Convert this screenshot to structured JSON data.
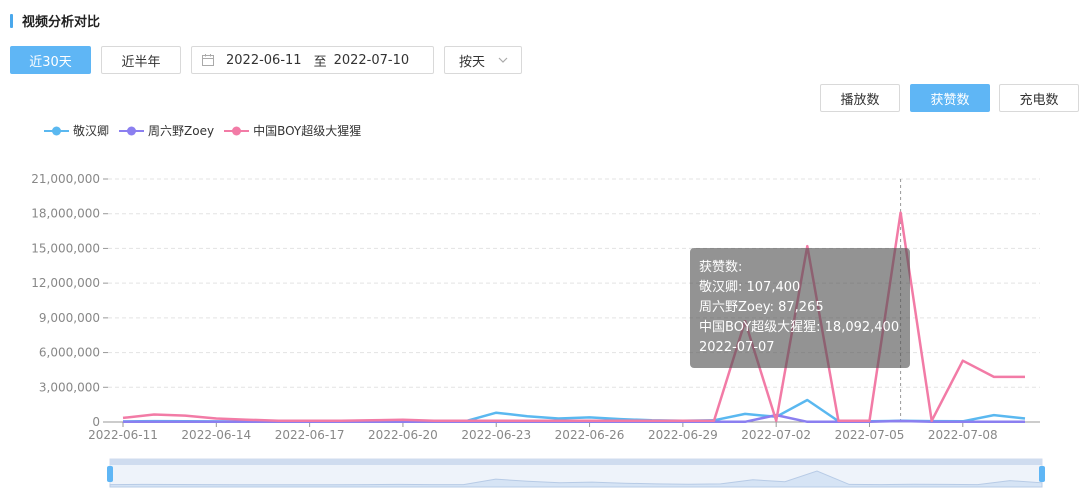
{
  "section": {
    "title": "视频分析对比"
  },
  "controls": {
    "range_30": "近30天",
    "range_half": "近半年",
    "date_start": "2022-06-11",
    "date_sep": "至",
    "date_end": "2022-07-10",
    "granularity": "按天"
  },
  "metrics": {
    "plays": "播放数",
    "likes": "获赞数",
    "charge": "充电数",
    "active": "获赞数"
  },
  "colors": {
    "accent": "#5fb6f5",
    "series1": "#5ab8f0",
    "series2": "#8b7ff0",
    "series3": "#f27ba6"
  },
  "chart_data": {
    "type": "line",
    "x": [
      "2022-06-11",
      "2022-06-12",
      "2022-06-13",
      "2022-06-14",
      "2022-06-15",
      "2022-06-16",
      "2022-06-17",
      "2022-06-18",
      "2022-06-19",
      "2022-06-20",
      "2022-06-21",
      "2022-06-22",
      "2022-06-23",
      "2022-06-24",
      "2022-06-25",
      "2022-06-26",
      "2022-06-27",
      "2022-06-28",
      "2022-06-29",
      "2022-06-30",
      "2022-07-01",
      "2022-07-02",
      "2022-07-03",
      "2022-07-04",
      "2022-07-05",
      "2022-07-06",
      "2022-07-07",
      "2022-07-08",
      "2022-07-09",
      "2022-07-10"
    ],
    "xticks": [
      "2022-06-11",
      "2022-06-14",
      "2022-06-17",
      "2022-06-20",
      "2022-06-23",
      "2022-06-26",
      "2022-06-29",
      "2022-07-02",
      "2022-07-05",
      "2022-07-08"
    ],
    "ylim": [
      0,
      21000000
    ],
    "yticks": [
      "0",
      "3,000,000",
      "6,000,000",
      "9,000,000",
      "12,000,000",
      "15,000,000",
      "18,000,000",
      "21,000,000"
    ],
    "grid": true,
    "legend_position": "top-left",
    "series": [
      {
        "name": "敬汉卿",
        "values": [
          50000,
          80000,
          70000,
          50000,
          40000,
          30000,
          30000,
          40000,
          60000,
          80000,
          50000,
          60000,
          800000,
          500000,
          300000,
          400000,
          250000,
          150000,
          100000,
          150000,
          700000,
          450000,
          1900000,
          80000,
          60000,
          107400,
          80000,
          60000,
          600000,
          300000
        ]
      },
      {
        "name": "周六野Zoey",
        "values": [
          30000,
          30000,
          30000,
          20000,
          20000,
          20000,
          20000,
          20000,
          20000,
          20000,
          20000,
          20000,
          20000,
          20000,
          20000,
          20000,
          20000,
          20000,
          20000,
          20000,
          20000,
          600000,
          20000,
          20000,
          20000,
          87265,
          20000,
          20000,
          20000,
          20000
        ]
      },
      {
        "name": "中国BOY超级大猩猩",
        "values": [
          350000,
          650000,
          550000,
          300000,
          200000,
          100000,
          100000,
          100000,
          150000,
          200000,
          100000,
          100000,
          100000,
          100000,
          100000,
          100000,
          100000,
          100000,
          100000,
          100000,
          8700000,
          100000,
          15200000,
          100000,
          100000,
          18092400,
          100000,
          5300000,
          3900000,
          3900000
        ]
      }
    ],
    "tooltip": {
      "title": "获赞数:",
      "lines": [
        "敬汉卿: 107,400",
        "周六野Zoey: 87,265",
        "中国BOY超级大猩猩: 18,092,400"
      ],
      "date": "2022-07-07",
      "index": 25
    }
  }
}
